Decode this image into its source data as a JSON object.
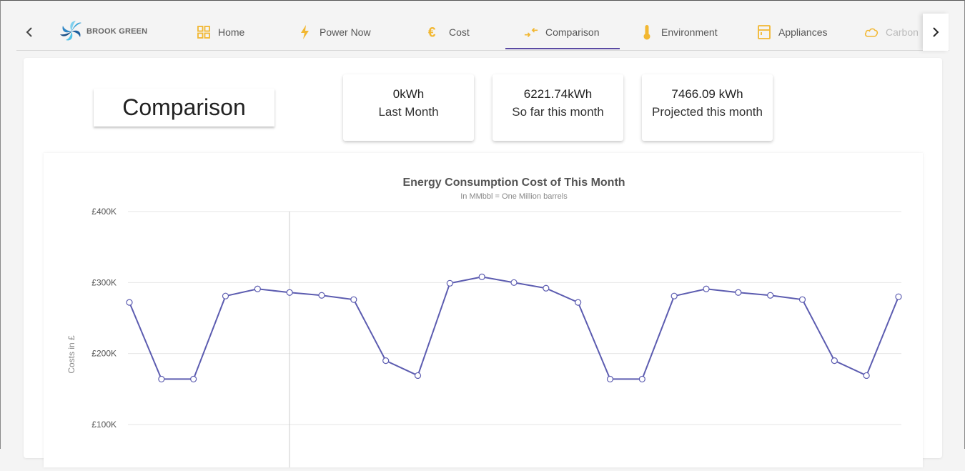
{
  "brand": {
    "name": "BROOK GREEN"
  },
  "nav": {
    "tabs": [
      {
        "label": "Home",
        "icon": "grid-icon"
      },
      {
        "label": "Power Now",
        "icon": "lightning-icon"
      },
      {
        "label": "Cost",
        "icon": "euro-icon"
      },
      {
        "label": "Comparison",
        "icon": "compare-arrows-icon",
        "active": true
      },
      {
        "label": "Environment",
        "icon": "thermometer-icon"
      },
      {
        "label": "Appliances",
        "icon": "appliance-icon"
      },
      {
        "label": "Carbon",
        "icon": "cloud-icon"
      }
    ],
    "accent": "#5a4aa3",
    "icon_color": "#f2b731"
  },
  "page": {
    "title": "Comparison"
  },
  "stats": [
    {
      "value": "0kWh",
      "label": "Last Month"
    },
    {
      "value": "6221.74kWh",
      "label": "So far this month"
    },
    {
      "value": "7466.09 kWh",
      "label": "Projected this month"
    }
  ],
  "chart_data": {
    "type": "line",
    "title": "Energy Consumption Cost of This Month",
    "subtitle": "In MMbbl = One Million barrels",
    "ylabel": "Costs in £",
    "xlabel": "",
    "ylim": [
      100000,
      400000
    ],
    "yticks": [
      "£400K",
      "£300K",
      "£200K",
      "£100K"
    ],
    "ytick_values": [
      400000,
      300000,
      200000,
      100000
    ],
    "grid": true,
    "line_color": "#5c5cb0",
    "series": [
      {
        "values": [
          272000,
          164000,
          164000,
          281000,
          291000,
          286000,
          282000,
          276000,
          190000,
          169000,
          299000,
          308000,
          300000,
          292000,
          272000,
          164000,
          164000,
          281000,
          291000,
          286000,
          282000,
          276000,
          190000,
          169000,
          280000
        ]
      }
    ]
  }
}
